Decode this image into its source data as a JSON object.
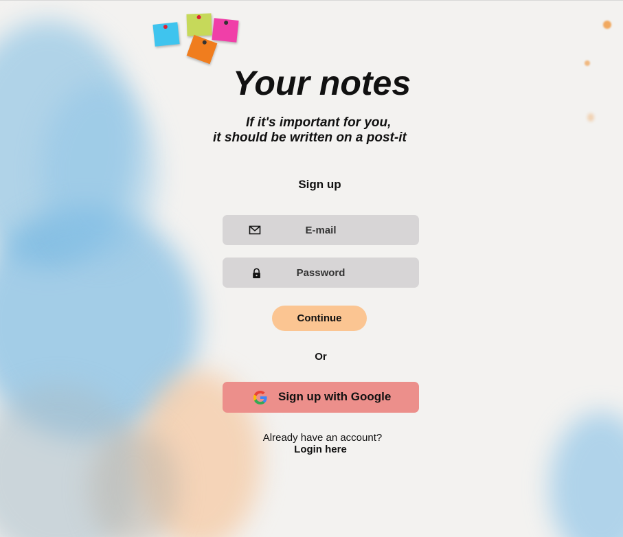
{
  "app": {
    "title": "Your notes",
    "tagline_line1": "If it's important for you,",
    "tagline_line2": "it should be written on a post-it"
  },
  "form": {
    "heading": "Sign up",
    "email": {
      "placeholder": "E-mail",
      "value": "",
      "icon": "mail-icon"
    },
    "password": {
      "placeholder": "Password",
      "value": "",
      "icon": "lock-icon"
    },
    "continue_label": "Continue",
    "or_label": "Or",
    "google_label": "Sign up with Google",
    "google_icon": "google-icon"
  },
  "footer": {
    "already_text": "Already have an account?",
    "login_label": "Login here"
  },
  "colors": {
    "background": "#f3f2f0",
    "field": "#d7d5d6",
    "continue_button": "#fbc592",
    "google_button": "#ec8f8b",
    "postit_blue": "#3fc4ee",
    "postit_green": "#c6d95a",
    "postit_pink": "#f03fa8",
    "postit_orange": "#f07d1e"
  }
}
